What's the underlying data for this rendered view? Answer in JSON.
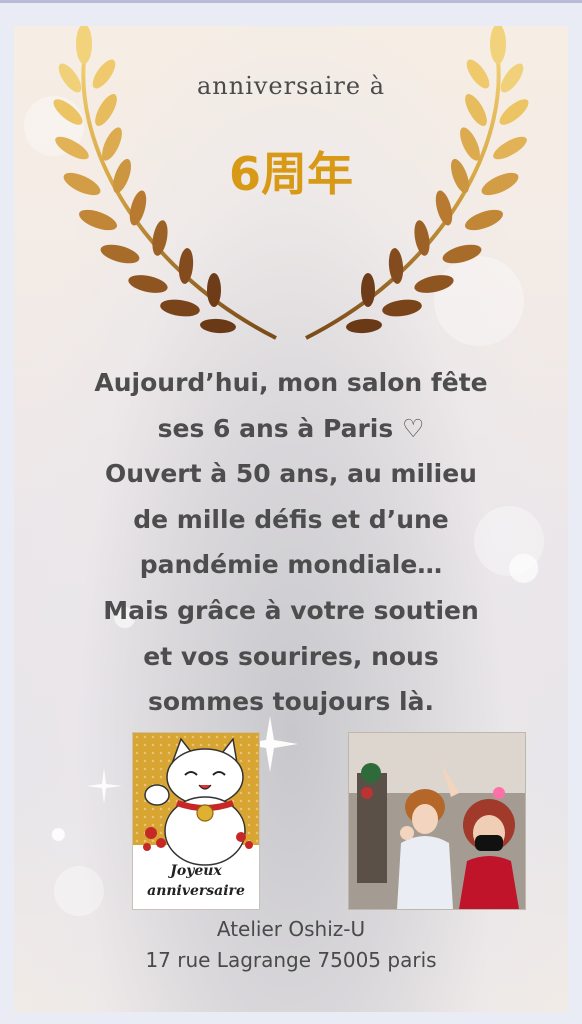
{
  "header": {
    "title": "anniversaire à",
    "years": "6周年"
  },
  "message": {
    "lines": [
      "Aujourd’hui, mon salon fête",
      "ses 6 ans à Paris ♡",
      "Ouvert à 50 ans, au milieu",
      "de mille défis et d’une",
      "pandémie mondiale…",
      "Mais grâce à votre soutien",
      "et vos sourires, nous",
      "sommes toujours là."
    ]
  },
  "card": {
    "line1": "Joyeux",
    "line2": "anniversaire"
  },
  "footer": {
    "name": "Atelier Oshiz-U",
    "address": "17 rue Lagrange 75005 paris"
  },
  "colors": {
    "gold": "#d89a16",
    "text": "#4d4d4d"
  }
}
